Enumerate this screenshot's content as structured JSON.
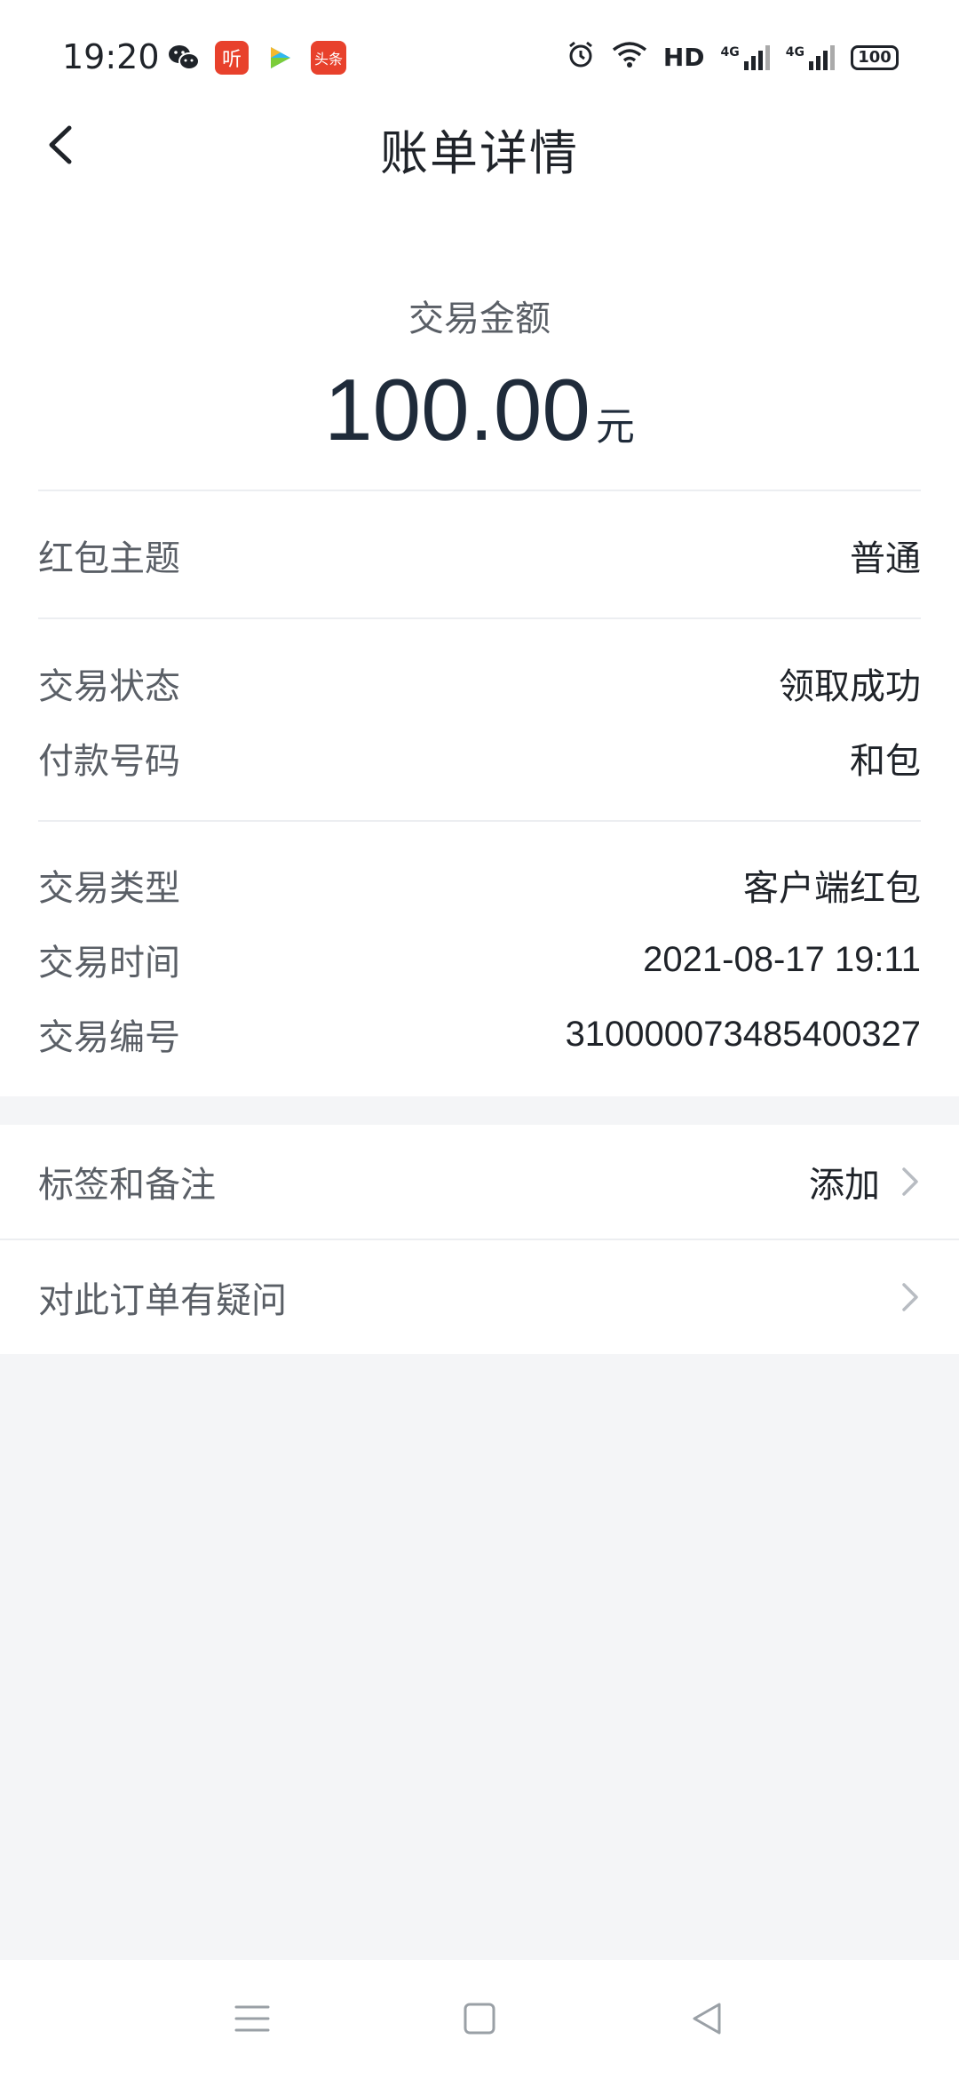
{
  "status_bar": {
    "time": "19:20",
    "notification_icons": [
      "wechat-icon",
      "ting-app-icon",
      "video-app-icon",
      "toutiao-app-icon"
    ],
    "ting_label": "听",
    "toutiao_label": "头条",
    "hd_label": "HD",
    "network_label_1": "4G",
    "network_label_2": "4G",
    "battery": "100"
  },
  "header": {
    "title": "账单详情"
  },
  "amount": {
    "label": "交易金额",
    "value": "100.00",
    "unit": "元"
  },
  "details": [
    {
      "label": "红包主题",
      "value": "普通"
    },
    {
      "label": "交易状态",
      "value": "领取成功"
    },
    {
      "label": "付款号码",
      "value": "和包"
    },
    {
      "label": "交易类型",
      "value": "客户端红包"
    },
    {
      "label": "交易时间",
      "value": "2021-08-17 19:11"
    },
    {
      "label": "交易编号",
      "value": "310000073485400327"
    }
  ],
  "actions": {
    "tags": {
      "label": "标签和备注",
      "value": "添加"
    },
    "question": {
      "label": "对此订单有疑问"
    }
  },
  "colors": {
    "background": "#f4f5f7",
    "card": "#ffffff",
    "label_text": "#5a5f66",
    "value_text": "#1f2329"
  }
}
